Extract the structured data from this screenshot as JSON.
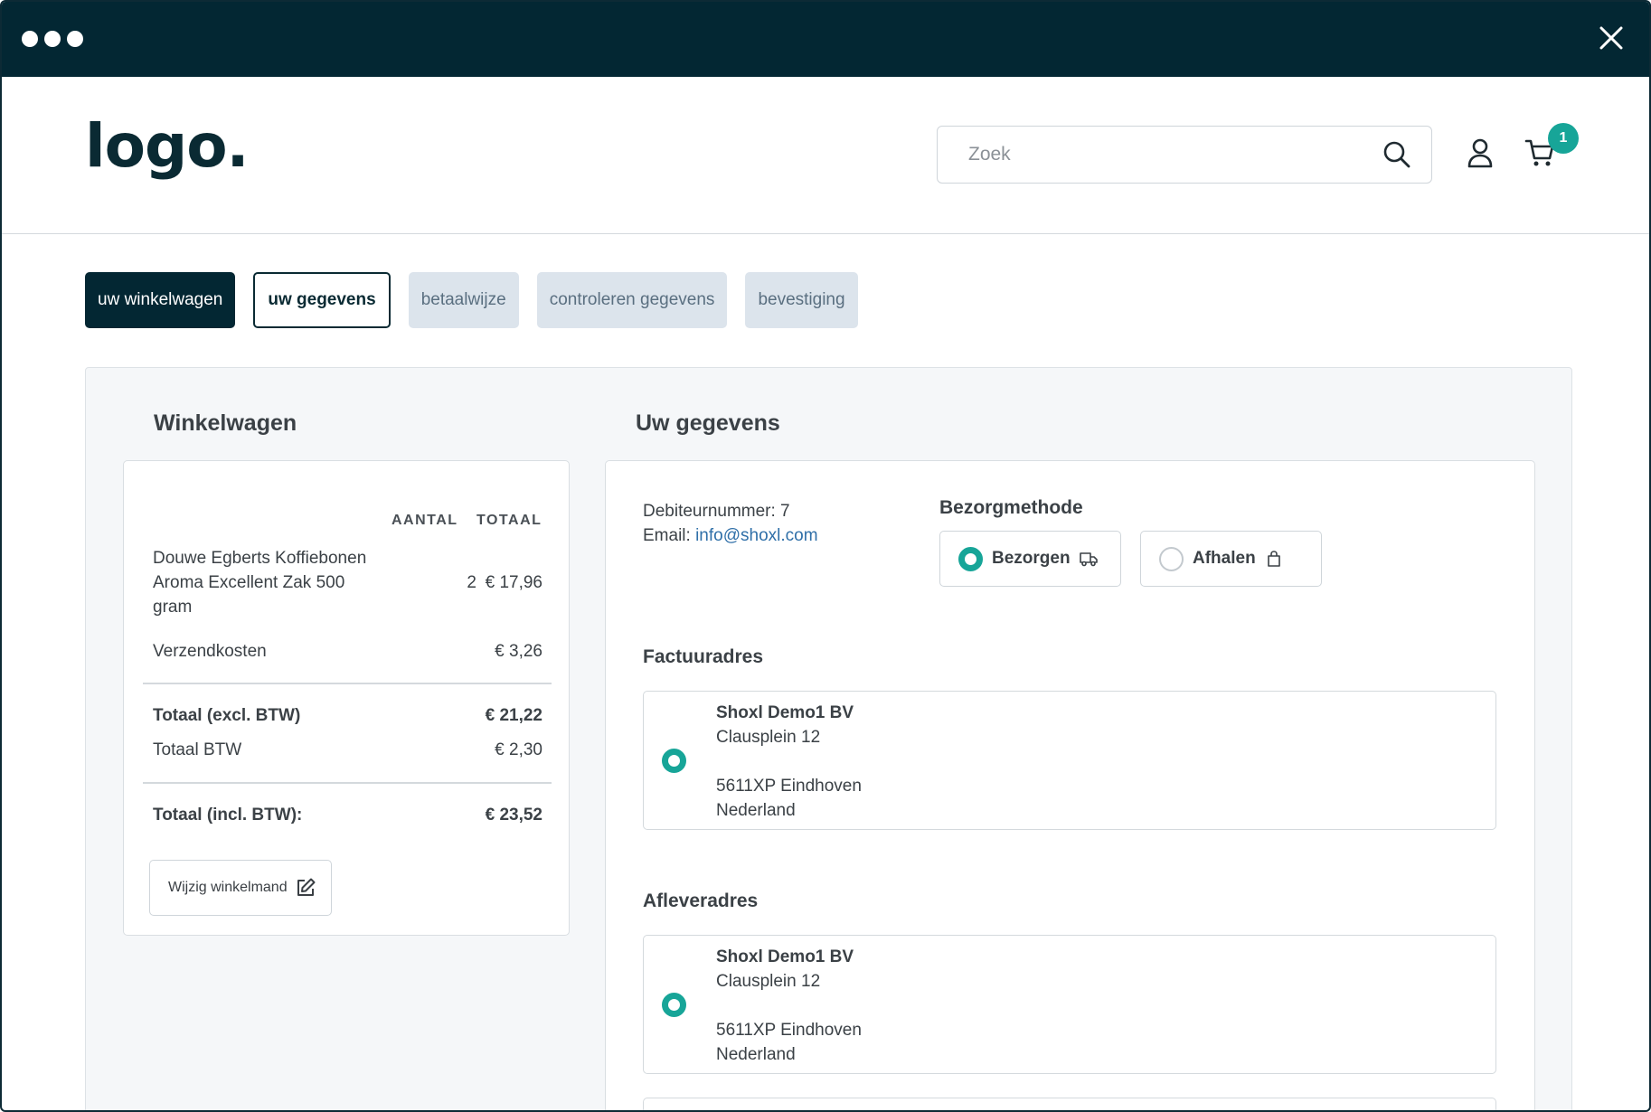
{
  "header": {
    "logo": "logo.",
    "search_placeholder": "Zoek",
    "cart_count": "1"
  },
  "steps": [
    {
      "label": "uw winkelwagen",
      "state": "done"
    },
    {
      "label": "uw gegevens",
      "state": "active"
    },
    {
      "label": "betaalwijze",
      "state": "todo"
    },
    {
      "label": "controleren gegevens",
      "state": "todo"
    },
    {
      "label": "bevestiging",
      "state": "todo"
    }
  ],
  "cart": {
    "title": "Winkelwagen",
    "columns": {
      "qty": "AANTAL",
      "total": "TOTAAL"
    },
    "item": {
      "name_lines": [
        "Douwe Egberts Koffiebonen",
        "Aroma Excellent Zak 500",
        "gram"
      ],
      "qty": "2",
      "total": "€ 17,96"
    },
    "shipping": {
      "label": "Verzendkosten",
      "value": "€ 3,26"
    },
    "subtotal_excl": {
      "label": "Totaal (excl. BTW)",
      "value": "€ 21,22"
    },
    "vat": {
      "label": "Totaal BTW",
      "value": "€ 2,30"
    },
    "total_incl": {
      "label": "Totaal (incl. BTW):",
      "value": "€ 23,52"
    },
    "edit_button": "Wijzig winkelmand"
  },
  "details": {
    "title": "Uw gegevens",
    "debtor_label": "Debiteurnummer: 7",
    "email_label": "Email:",
    "email": "info@shoxl.com",
    "delivery_method": {
      "title": "Bezorgmethode",
      "options": [
        {
          "label": "Bezorgen",
          "icon": "truck-icon",
          "selected": true
        },
        {
          "label": "Afhalen",
          "icon": "bag-icon",
          "selected": false
        }
      ]
    },
    "billing": {
      "title": "Factuuradres",
      "company": "Shoxl Demo1 BV",
      "street": "Clausplein 12",
      "city": "5611XP Eindhoven",
      "country": "Nederland"
    },
    "shipping_address": {
      "title": "Afleveradres",
      "company": "Shoxl Demo1 BV",
      "street": "Clausplein 12",
      "city": "5611XP Eindhoven",
      "country": "Nederland"
    }
  },
  "colors": {
    "titlebar": "#032733",
    "accent": "#17a598",
    "step_todo": "#dce4ec",
    "link": "#2f6fa8"
  }
}
